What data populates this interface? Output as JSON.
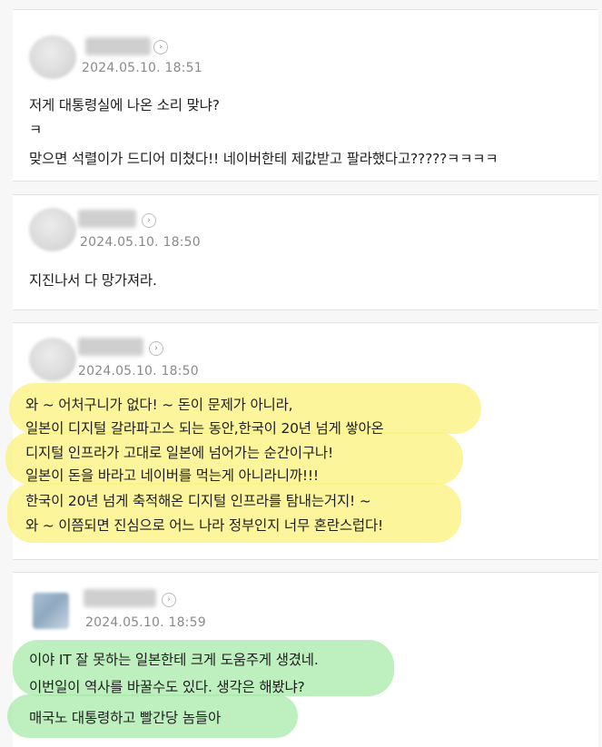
{
  "comments": [
    {
      "date": "2024.05.10.  18:51",
      "profile_button": "›",
      "lines": [
        "저게 대통령실에 나온 소리 맞냐?",
        "ㅋ",
        "맞으면 석렬이가 드디어 미쳤다!! 네이버한테 제값받고 팔라했다고?????ㅋㅋㅋㅋ"
      ]
    },
    {
      "date": "2024.05.10.  18:50",
      "profile_button": "›",
      "lines": [
        "지진나서 다 망가져라."
      ]
    },
    {
      "date": "2024.05.10.  18:50",
      "profile_button": "›",
      "lines": [
        "와 ~ 어처구니가 없다! ~ 돈이 문제가 아니라,",
        "일본이 디지털 갈라파고스 되는 동안,한국이 20년 넘게 쌓아온",
        "디지털  인프라가 고대로 일본에 넘어가는 순간이구나!",
        "일본이 돈을 바라고 네이버를 먹는게 아니라니까!!!",
        "한국이 20년 넘게 축적해온 디지털 인프라를 탐내는거지! ~",
        "와 ~ 이쯤되면 진심으로 어느 나라 정부인지 너무 혼란스럽다!"
      ],
      "highlight_color": "#fbf27a"
    },
    {
      "date": "2024.05.10.  18:59",
      "profile_button": "›",
      "lines": [
        "이야 IT 잘 못하는 일본한테 크게 도움주게 생겼네.",
        "이번일이 역사를 바꿀수도 있다. 생각은 해봤냐?",
        "매국노 대통령하고 빨간당 놈들아"
      ],
      "highlight_color": "#a8e9a8"
    }
  ]
}
